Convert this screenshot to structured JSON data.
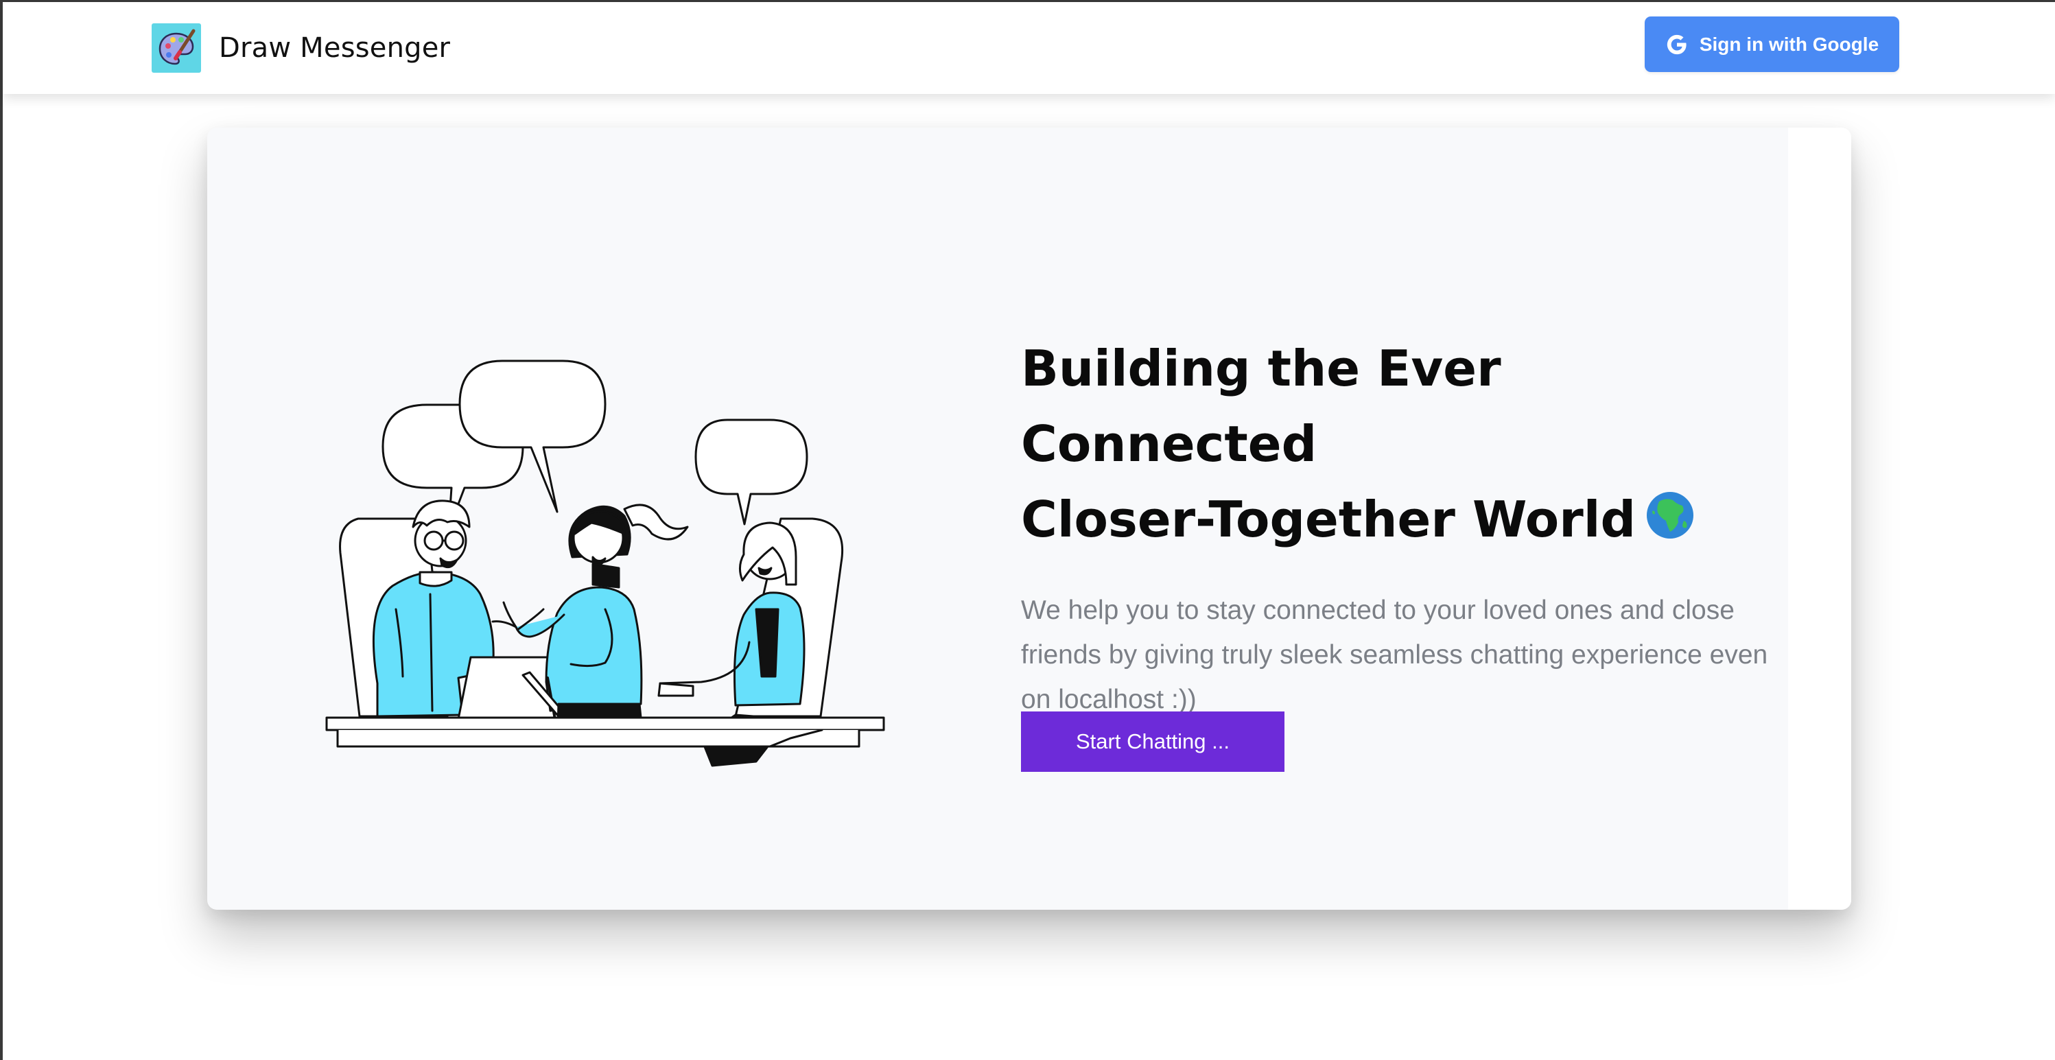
{
  "app": {
    "name": "Draw Messenger"
  },
  "header": {
    "logo_icon": "palette-paintbrush-icon",
    "sign_in_label": "Sign in with Google",
    "sign_in_icon": "google-g-icon"
  },
  "hero": {
    "headline_line1": "Building the Ever Connected",
    "headline_line2": "Closer-Together World",
    "headline_icon": "globe-africa-icon",
    "description": "We help you to stay connected to your loved ones and close friends by giving truly sleek seamless chatting experience even on localhost :))",
    "cta_label": "Start Chatting ..."
  },
  "illustration": {
    "name": "people-chatting-illustration"
  },
  "colors": {
    "accent": "#6d2bd9",
    "google_blue": "#4a8af4",
    "logo_bg": "#5fd6e6",
    "illustration_cyan": "#67e0fb",
    "card_bg": "#f8f9fb"
  }
}
